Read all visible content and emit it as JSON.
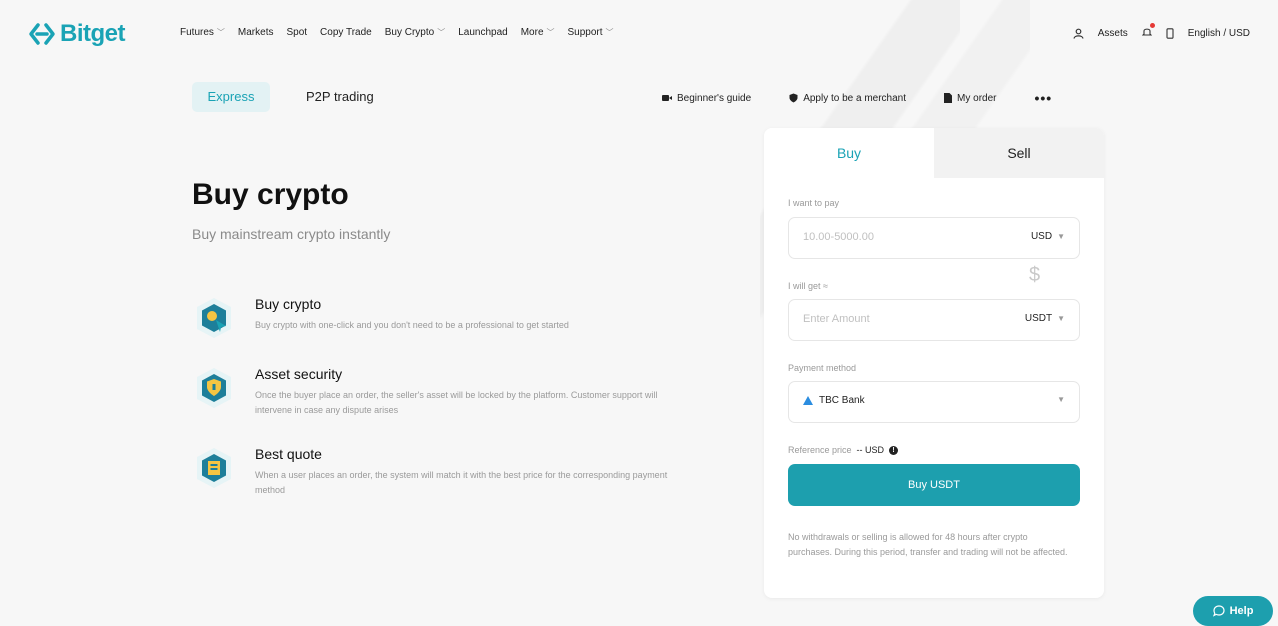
{
  "brand": {
    "name": "Bitget",
    "accent": "#1aa3b5"
  },
  "nav": {
    "items": [
      {
        "label": "Futures",
        "has_dropdown": true
      },
      {
        "label": "Markets",
        "has_dropdown": false
      },
      {
        "label": "Spot",
        "has_dropdown": false
      },
      {
        "label": "Copy Trade",
        "has_dropdown": false
      },
      {
        "label": "Buy Crypto",
        "has_dropdown": true
      },
      {
        "label": "Launchpad",
        "has_dropdown": false
      },
      {
        "label": "More",
        "has_dropdown": true
      },
      {
        "label": "Support",
        "has_dropdown": true
      }
    ],
    "assets_label": "Assets",
    "language_label": "English / USD"
  },
  "subnav": {
    "tabs": [
      "Express",
      "P2P trading"
    ],
    "links": [
      "Beginner's guide",
      "Apply to be a merchant",
      "My order"
    ],
    "more": "•••"
  },
  "hero": {
    "title": "Buy crypto",
    "subtitle": "Buy mainstream crypto instantly"
  },
  "features": [
    {
      "title": "Buy crypto",
      "desc": "Buy crypto with one-click and you don't need to be a professional to get started"
    },
    {
      "title": "Asset security",
      "desc": "Once the buyer place an order, the seller's asset will be locked by the platform. Customer support will intervene in case any dispute arises"
    },
    {
      "title": "Best quote",
      "desc": "When a user places an order, the system will match it with the best price for the corresponding payment method"
    }
  ],
  "trade": {
    "tabs": {
      "buy": "Buy",
      "sell": "Sell"
    },
    "pay_label": "I want to pay",
    "pay_placeholder": "10.00-5000.00",
    "pay_currency": "USD",
    "get_label": "I will get ≈",
    "get_placeholder": "Enter Amount",
    "get_currency": "USDT",
    "payment_label": "Payment method",
    "payment_value": "TBC Bank",
    "ref_label": "Reference price",
    "ref_value": "-- USD",
    "buy_button": "Buy USDT",
    "notice": "No withdrawals or selling is allowed for 48 hours after crypto purchases. During this period, transfer and trading will not be affected."
  },
  "help": {
    "label": "Help"
  },
  "glyphs": {
    "chevron": "﹀",
    "dollar": "$",
    "info": "!"
  }
}
